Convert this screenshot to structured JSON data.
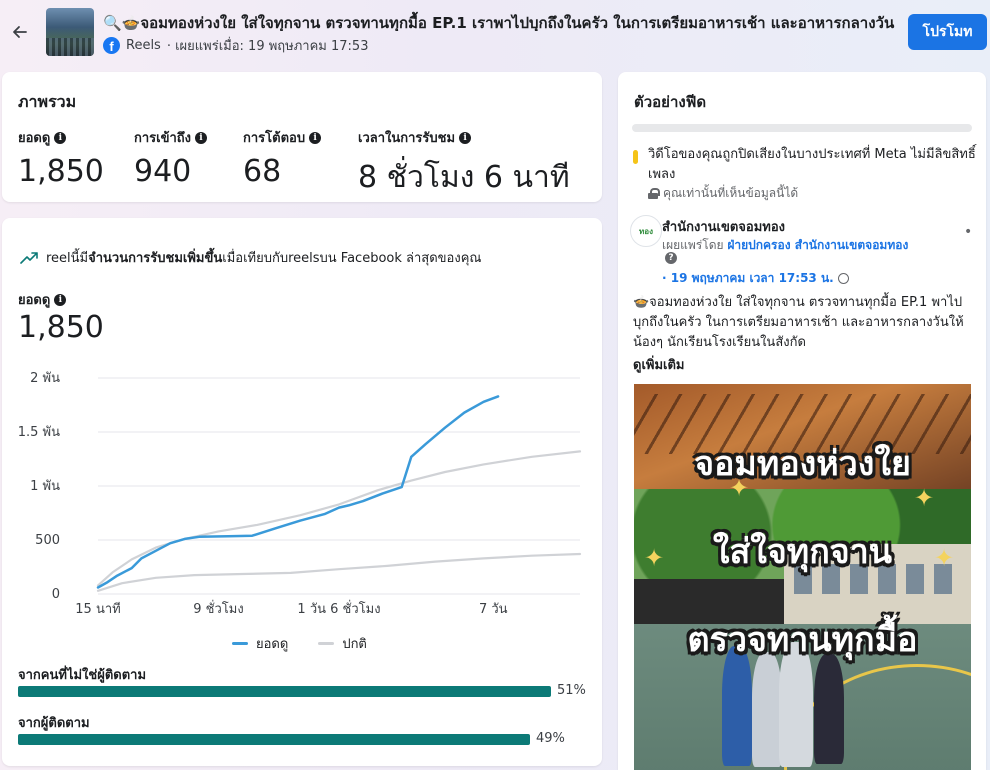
{
  "header": {
    "title": "🔍🍲จอมทองห่วงใย ใส่ใจทุกจาน ตรวจทานทุกมื้อ EP.1 เราพาไปบุกถึงในครัว ในการเตรียมอาหารเช้า และอาหารกลางวัน",
    "title_icons": [
      "magnifier-emoji",
      "bowl-emoji"
    ],
    "source": "Reels",
    "published": "· เผยแพร่เมื่อ: 19 พฤษภาคม 17:53",
    "promote_label": "โปรโมท"
  },
  "overview": {
    "title": "ภาพรวม",
    "metrics": [
      {
        "label": "ยอดดู",
        "value": "1,850"
      },
      {
        "label": "การเข้าถึง",
        "value": "940"
      },
      {
        "label": "การโต้ตอบ",
        "value": "68"
      },
      {
        "label": "เวลาในการรับชม",
        "value": "8 ชั่วโมง 6 นาที"
      }
    ]
  },
  "performance": {
    "trend_prefix": "reelนี้มี",
    "trend_bold": "จำนวนการรับชมเพิ่มขึ้น",
    "trend_suffix": "เมื่อเทียบกับreelsบน Facebook ล่าสุดของคุณ",
    "views_label": "ยอดดู",
    "views_value": "1,850",
    "legend": [
      {
        "name": "ยอดดู",
        "color": "#3a9ad9"
      },
      {
        "name": "ปกติ",
        "color": "#d0d2d6"
      }
    ],
    "audience": [
      {
        "label": "จากคนที่ไม่ใช่ผู้ติดตาม",
        "percent": 51,
        "percent_text": "51%"
      },
      {
        "label": "จากผู้ติดตาม",
        "percent": 49,
        "percent_text": "49%"
      }
    ]
  },
  "chart_data": {
    "type": "line",
    "title": "",
    "xlabel": "",
    "ylabel": "",
    "ylim": [
      0,
      2000
    ],
    "y_ticks": [
      {
        "value": 0,
        "label": "0"
      },
      {
        "value": 500,
        "label": "500"
      },
      {
        "value": 1000,
        "label": "1 พัน"
      },
      {
        "value": 1500,
        "label": "1.5 พัน"
      },
      {
        "value": 2000,
        "label": "2 พัน"
      }
    ],
    "x_ticks": [
      {
        "t": 0,
        "label": "15 นาที"
      },
      {
        "t": 0.25,
        "label": "9 ชั่วโมง"
      },
      {
        "t": 0.5,
        "label": "1 วัน 6 ชั่วโมง"
      },
      {
        "t": 0.82,
        "label": "7 วัน"
      }
    ],
    "grid": true,
    "legend_position": "bottom",
    "series": [
      {
        "name": "ยอดดู",
        "color": "#3a9ad9",
        "points": [
          [
            0,
            60
          ],
          [
            0.02,
            110
          ],
          [
            0.04,
            170
          ],
          [
            0.07,
            240
          ],
          [
            0.09,
            330
          ],
          [
            0.12,
            400
          ],
          [
            0.15,
            470
          ],
          [
            0.18,
            510
          ],
          [
            0.21,
            530
          ],
          [
            0.27,
            535
          ],
          [
            0.32,
            540
          ],
          [
            0.37,
            610
          ],
          [
            0.42,
            680
          ],
          [
            0.47,
            740
          ],
          [
            0.5,
            800
          ],
          [
            0.52,
            820
          ],
          [
            0.55,
            860
          ],
          [
            0.59,
            930
          ],
          [
            0.63,
            990
          ],
          [
            0.65,
            1270
          ],
          [
            0.68,
            1390
          ],
          [
            0.72,
            1540
          ],
          [
            0.76,
            1680
          ],
          [
            0.8,
            1780
          ],
          [
            0.83,
            1830
          ]
        ]
      },
      {
        "name": "ปกติ",
        "color": "#d0d2d6",
        "points": [
          [
            0,
            80
          ],
          [
            0.03,
            200
          ],
          [
            0.07,
            320
          ],
          [
            0.12,
            430
          ],
          [
            0.18,
            510
          ],
          [
            0.25,
            580
          ],
          [
            0.33,
            640
          ],
          [
            0.42,
            730
          ],
          [
            0.5,
            830
          ],
          [
            0.58,
            960
          ],
          [
            0.65,
            1050
          ],
          [
            0.72,
            1130
          ],
          [
            0.8,
            1200
          ],
          [
            0.9,
            1270
          ],
          [
            1.0,
            1320
          ]
        ]
      },
      {
        "name": "",
        "color": "#d0d2d6",
        "points": [
          [
            0,
            30
          ],
          [
            0.05,
            100
          ],
          [
            0.12,
            150
          ],
          [
            0.2,
            175
          ],
          [
            0.3,
            185
          ],
          [
            0.4,
            195
          ],
          [
            0.5,
            230
          ],
          [
            0.6,
            260
          ],
          [
            0.7,
            300
          ],
          [
            0.8,
            330
          ],
          [
            0.9,
            355
          ],
          [
            1.0,
            370
          ]
        ]
      }
    ]
  },
  "feed": {
    "title": "ตัวอย่างฟีด",
    "mute_notice": "วิดีโอของคุณถูกปิดเสียงในบางประเทศที่ Meta ไม่มีลิขสิทธิ์เพลง",
    "only_you": "คุณเท่านั้นที่เห็นข้อมูลนี้ได้",
    "page_name": "สำนักงานเขตจอมทอง",
    "avatar_text": "ทอง",
    "published_by_prefix": "เผยแพร่โดย ",
    "published_by_link": "ฝ่ายปกครอง สำนักงานเขตจอมทอง",
    "post_date": "· 19 พฤษภาคม เวลา 17:53 น.",
    "post_text": "🍲จอมทองห่วงใย ใส่ใจทุกจาน ตรวจทานทุกมื้อ EP.1 พาไปบุกถึงในครัว ในการเตรียมอาหารเช้า และอาหารกลางวันให้น้องๆ นักเรียนโรงเรียนในสังกัด",
    "see_more": "ดูเพิ่มเติม",
    "video_captions": [
      "จอมทองห่วงใย",
      "ใส่ใจทุกจาน",
      "ตรวจทานทุกมื้อ"
    ]
  }
}
